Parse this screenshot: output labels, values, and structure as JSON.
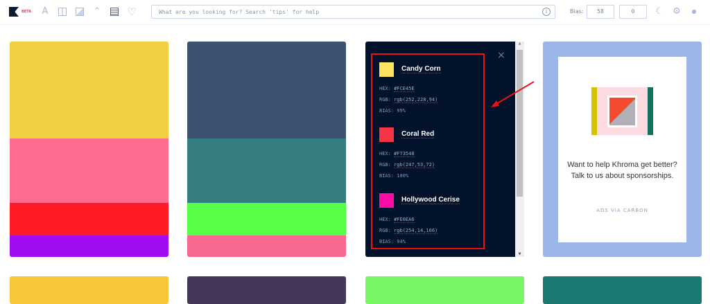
{
  "header": {
    "beta": "BETA",
    "search_placeholder": "What are you looking for? Search 'tips' for help",
    "info": "i",
    "bias_label": "Bias:",
    "bias_value_1": "58",
    "bias_value_2": "0",
    "icons": [
      "type-icon",
      "columns-icon",
      "gradient-icon",
      "image-icon",
      "palette-icon",
      "heart-icon"
    ]
  },
  "cards": [
    {
      "colors": [
        "#F0D040",
        "#FF6B8F",
        "#FF1A25",
        "#A10CF0"
      ]
    },
    {
      "colors": [
        "#3D5170",
        "#377E80",
        "#58FF48",
        "#F96890"
      ]
    }
  ],
  "panel": {
    "close": "×",
    "entries": [
      {
        "name": "Candy Corn",
        "swatch": "#FCE45E",
        "hex_label": "HEX:",
        "hex": "#FCE45E",
        "rgb_label": "RGB:",
        "rgb": "rgb(252,228,94)",
        "bias_label": "BIAS:",
        "bias": "99%"
      },
      {
        "name": "Coral Red",
        "swatch": "#F73548",
        "hex_label": "HEX:",
        "hex": "#F73548",
        "rgb_label": "RGB:",
        "rgb": "rgb(247,53,72)",
        "bias_label": "BIAS:",
        "bias": "100%"
      },
      {
        "name": "Hollywood Cerise",
        "swatch": "#FE0EA6",
        "hex_label": "HEX:",
        "hex": "#FE0EA6",
        "rgb_label": "RGB:",
        "rgb": "rgb(254,14,166)",
        "bias_label": "BIAS:",
        "bias": "94%"
      }
    ]
  },
  "ad": {
    "text": "Want to help Khroma get better? Talk to us about sponsorships.",
    "footer": "ADS VIA CARBON"
  },
  "bottom_row": [
    "#F9C63A",
    "#45375A",
    "#77F764",
    "#1A7A72"
  ]
}
